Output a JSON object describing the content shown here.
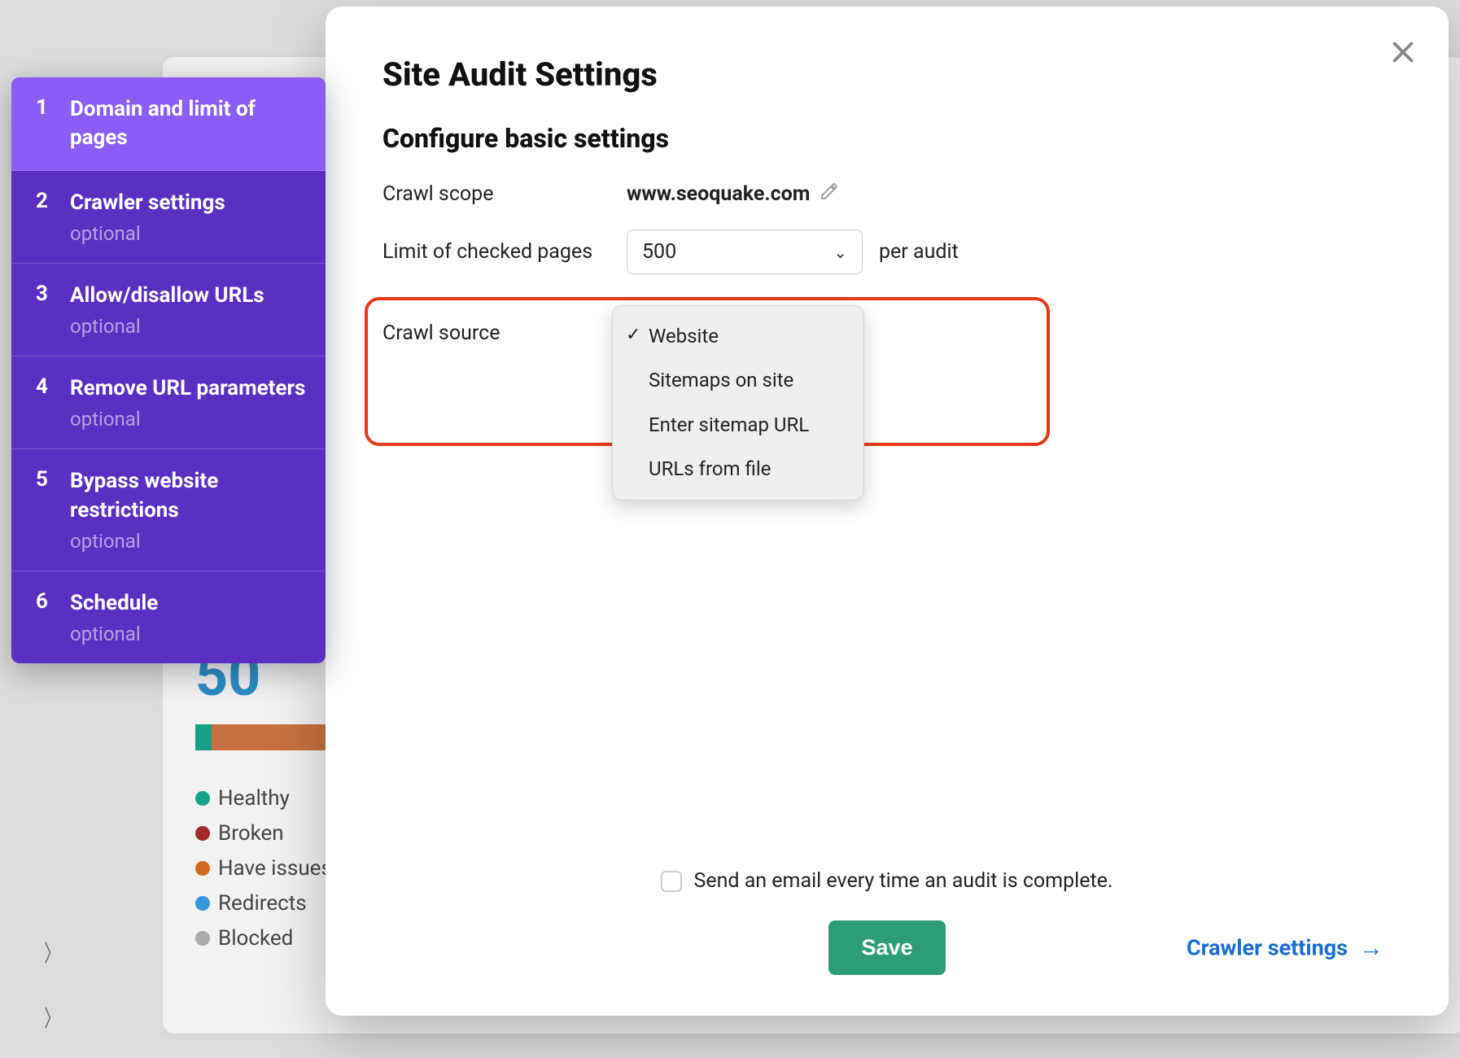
{
  "sidebar": {
    "steps": [
      {
        "num": "1",
        "title": "Domain and limit of pages",
        "optional": ""
      },
      {
        "num": "2",
        "title": "Crawler settings",
        "optional": "optional"
      },
      {
        "num": "3",
        "title": "Allow/disallow URLs",
        "optional": "optional"
      },
      {
        "num": "4",
        "title": "Remove URL parameters",
        "optional": "optional"
      },
      {
        "num": "5",
        "title": "Bypass website restrictions",
        "optional": "optional"
      },
      {
        "num": "6",
        "title": "Schedule",
        "optional": "optional"
      }
    ]
  },
  "modal": {
    "title": "Site Audit Settings",
    "subtitle": "Configure basic settings",
    "crawl_scope_label": "Crawl scope",
    "crawl_scope_value": "www.seoquake.com",
    "limit_label": "Limit of checked pages",
    "limit_value": "500",
    "limit_suffix": "per audit",
    "crawl_source_label": "Crawl source",
    "crawl_source_options": [
      "Website",
      "Sitemaps on site",
      "Enter sitemap URL",
      "URLs from file"
    ],
    "crawl_source_selected": "Website",
    "email_label": "Send an email every time an audit is complete.",
    "save_label": "Save",
    "next_label": "Crawler settings"
  },
  "background": {
    "stat": "50",
    "legend": [
      "Healthy",
      "Broken",
      "Have issues",
      "Redirects",
      "Blocked"
    ]
  }
}
